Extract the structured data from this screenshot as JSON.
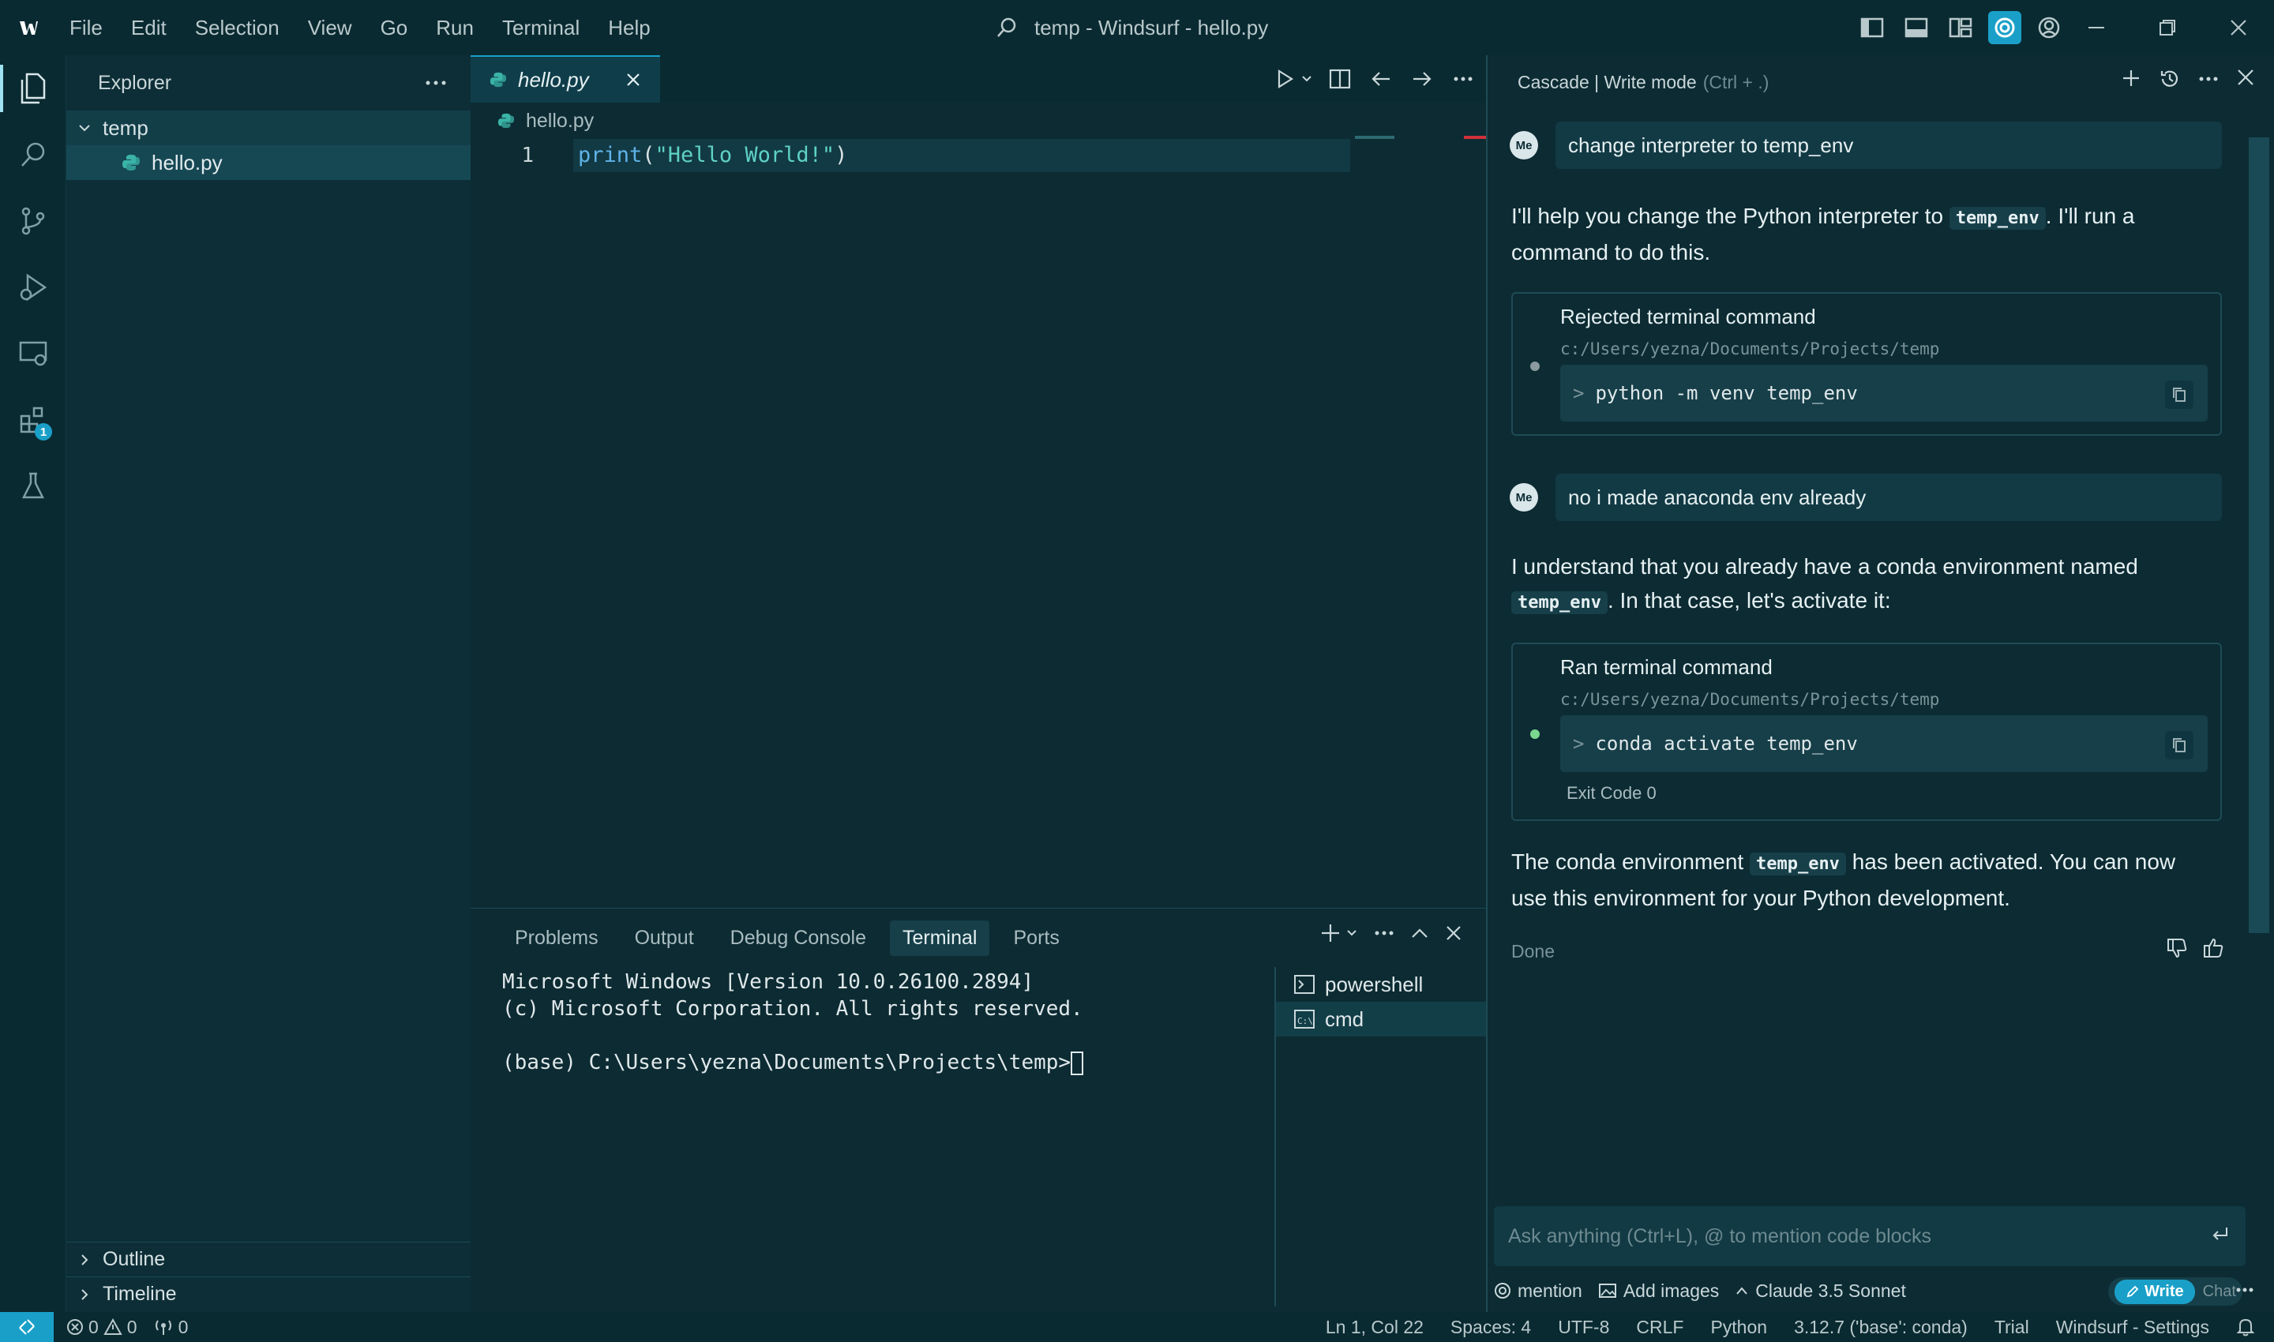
{
  "window": {
    "title": "temp - Windsurf - hello.py",
    "menu": [
      "File",
      "Edit",
      "Selection",
      "View",
      "Go",
      "Run",
      "Terminal",
      "Help"
    ]
  },
  "activity_bar": {
    "items": [
      "explorer-icon",
      "search-icon",
      "source-control-icon",
      "run-debug-icon",
      "remote-explorer-icon",
      "extensions-icon",
      "testing-icon"
    ],
    "extensions_badge": "1"
  },
  "sidebar": {
    "title": "Explorer",
    "folder": "temp",
    "file": "hello.py",
    "outline": "Outline",
    "timeline": "Timeline"
  },
  "editor": {
    "tab": "hello.py",
    "breadcrumb": "hello.py",
    "line_number": "1",
    "code": {
      "fn": "print",
      "open": "(",
      "str": "\"Hello World!\"",
      "close": ")"
    }
  },
  "panel": {
    "tabs": [
      "Problems",
      "Output",
      "Debug Console",
      "Terminal",
      "Ports"
    ],
    "active_tab": "Terminal",
    "terminal_lines": [
      "Microsoft Windows [Version 10.0.26100.2894]",
      "(c) Microsoft Corporation. All rights reserved.",
      "",
      "(base) C:\\Users\\yezna\\Documents\\Projects\\temp>"
    ],
    "terminals": [
      "powershell",
      "cmd"
    ]
  },
  "cascade": {
    "title": "Cascade | Write mode",
    "shortcut": "(Ctrl + .)",
    "avatar": "Me",
    "messages": {
      "user1": "change interpreter to temp_env",
      "reply1_a": "I'll help you change the Python interpreter to ",
      "reply1_code": "temp_env",
      "reply1_b": ". I'll run a command to do this.",
      "cmd1_label": "Rejected terminal command",
      "cmd1_path": "c:/Users/yezna/Documents/Projects/temp",
      "cmd1": "python -m venv temp_env",
      "user2": "no i made anaconda env already",
      "reply2_a": "I understand that you already have a conda environment named ",
      "reply2_code": "temp_env",
      "reply2_b": ". In that case, let's activate it:",
      "cmd2_label": "Ran terminal command",
      "cmd2_path": "c:/Users/yezna/Documents/Projects/temp",
      "cmd2": "conda activate temp_env",
      "cmd2_exit": "Exit Code 0",
      "reply3_a": "The conda environment ",
      "reply3_code": "temp_env",
      "reply3_b": " has been activated. You can now use this environment for your Python development.",
      "done": "Done"
    },
    "input_placeholder": "Ask anything (Ctrl+L), @ to mention code blocks",
    "footer": {
      "mention": "mention",
      "add_images": "Add images",
      "model": "Claude 3.5 Sonnet",
      "write": "Write",
      "chat": "Chat"
    }
  },
  "statusbar": {
    "errors": "0",
    "warnings": "0",
    "ports": "0",
    "position": "Ln 1, Col 22",
    "spaces": "Spaces: 4",
    "encoding": "UTF-8",
    "eol": "CRLF",
    "language": "Python",
    "interpreter": "3.12.7 ('base': conda)",
    "trial": "Trial",
    "settings": "Windsurf - Settings"
  },
  "colors": {
    "accent": "#1aa0c8",
    "background": "#0d2e36",
    "success_dot": "#7bd88f",
    "rejected_dot": "#8a9a9e"
  }
}
